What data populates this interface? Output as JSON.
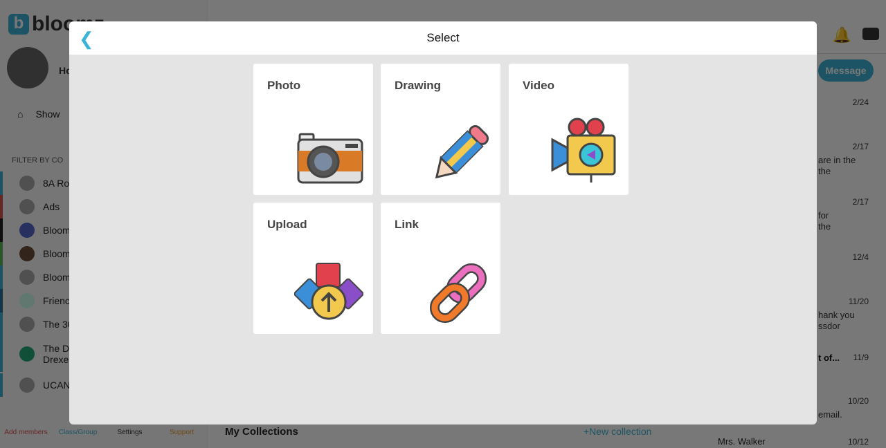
{
  "app": {
    "logo_text": "bloomz",
    "user_name": "Ho",
    "show_label": "Show",
    "filter_label": "FILTER BY CO",
    "communities": [
      "8A Ro",
      "Ads",
      "Bloom",
      "Bloom",
      "Bloom",
      "Frienc",
      "The 30",
      "The D Drexe",
      "UCAN"
    ],
    "community_colors": [
      "#3bb3d6",
      "#d9534f",
      "#222222",
      "#5cb85c",
      "#3bb3d6",
      "#2a6f97",
      "#3bb3d6",
      "#3bb3d6",
      "#3bb3d6"
    ],
    "bottom_nav": [
      {
        "label": "Add members",
        "color": "#d9534f"
      },
      {
        "label": "Class/Group",
        "color": "#3bb3d6"
      },
      {
        "label": "Settings",
        "color": "#333333"
      },
      {
        "label": "Support",
        "color": "#e89a2c"
      }
    ],
    "message_button": "Message",
    "dates": [
      "2/24",
      "2/17",
      "2/17",
      "12/4",
      "11/20",
      "11/9",
      "10/20",
      "10/12"
    ],
    "previews": [
      "are in the",
      "the",
      "for",
      "the",
      "hank you",
      "ssdor",
      "t of...",
      "email."
    ],
    "collections_title": "My Collections",
    "new_collection": "+New collection",
    "contact": "Mrs. Walker"
  },
  "modal": {
    "title": "Select",
    "back_icon": "chevron-left-icon",
    "options": [
      {
        "label": "Photo",
        "icon": "camera-icon"
      },
      {
        "label": "Drawing",
        "icon": "pencil-icon"
      },
      {
        "label": "Video",
        "icon": "video-camera-icon"
      },
      {
        "label": "Upload",
        "icon": "upload-icon"
      },
      {
        "label": "Link",
        "icon": "link-icon"
      }
    ]
  },
  "colors": {
    "accent": "#3bb3d6"
  }
}
